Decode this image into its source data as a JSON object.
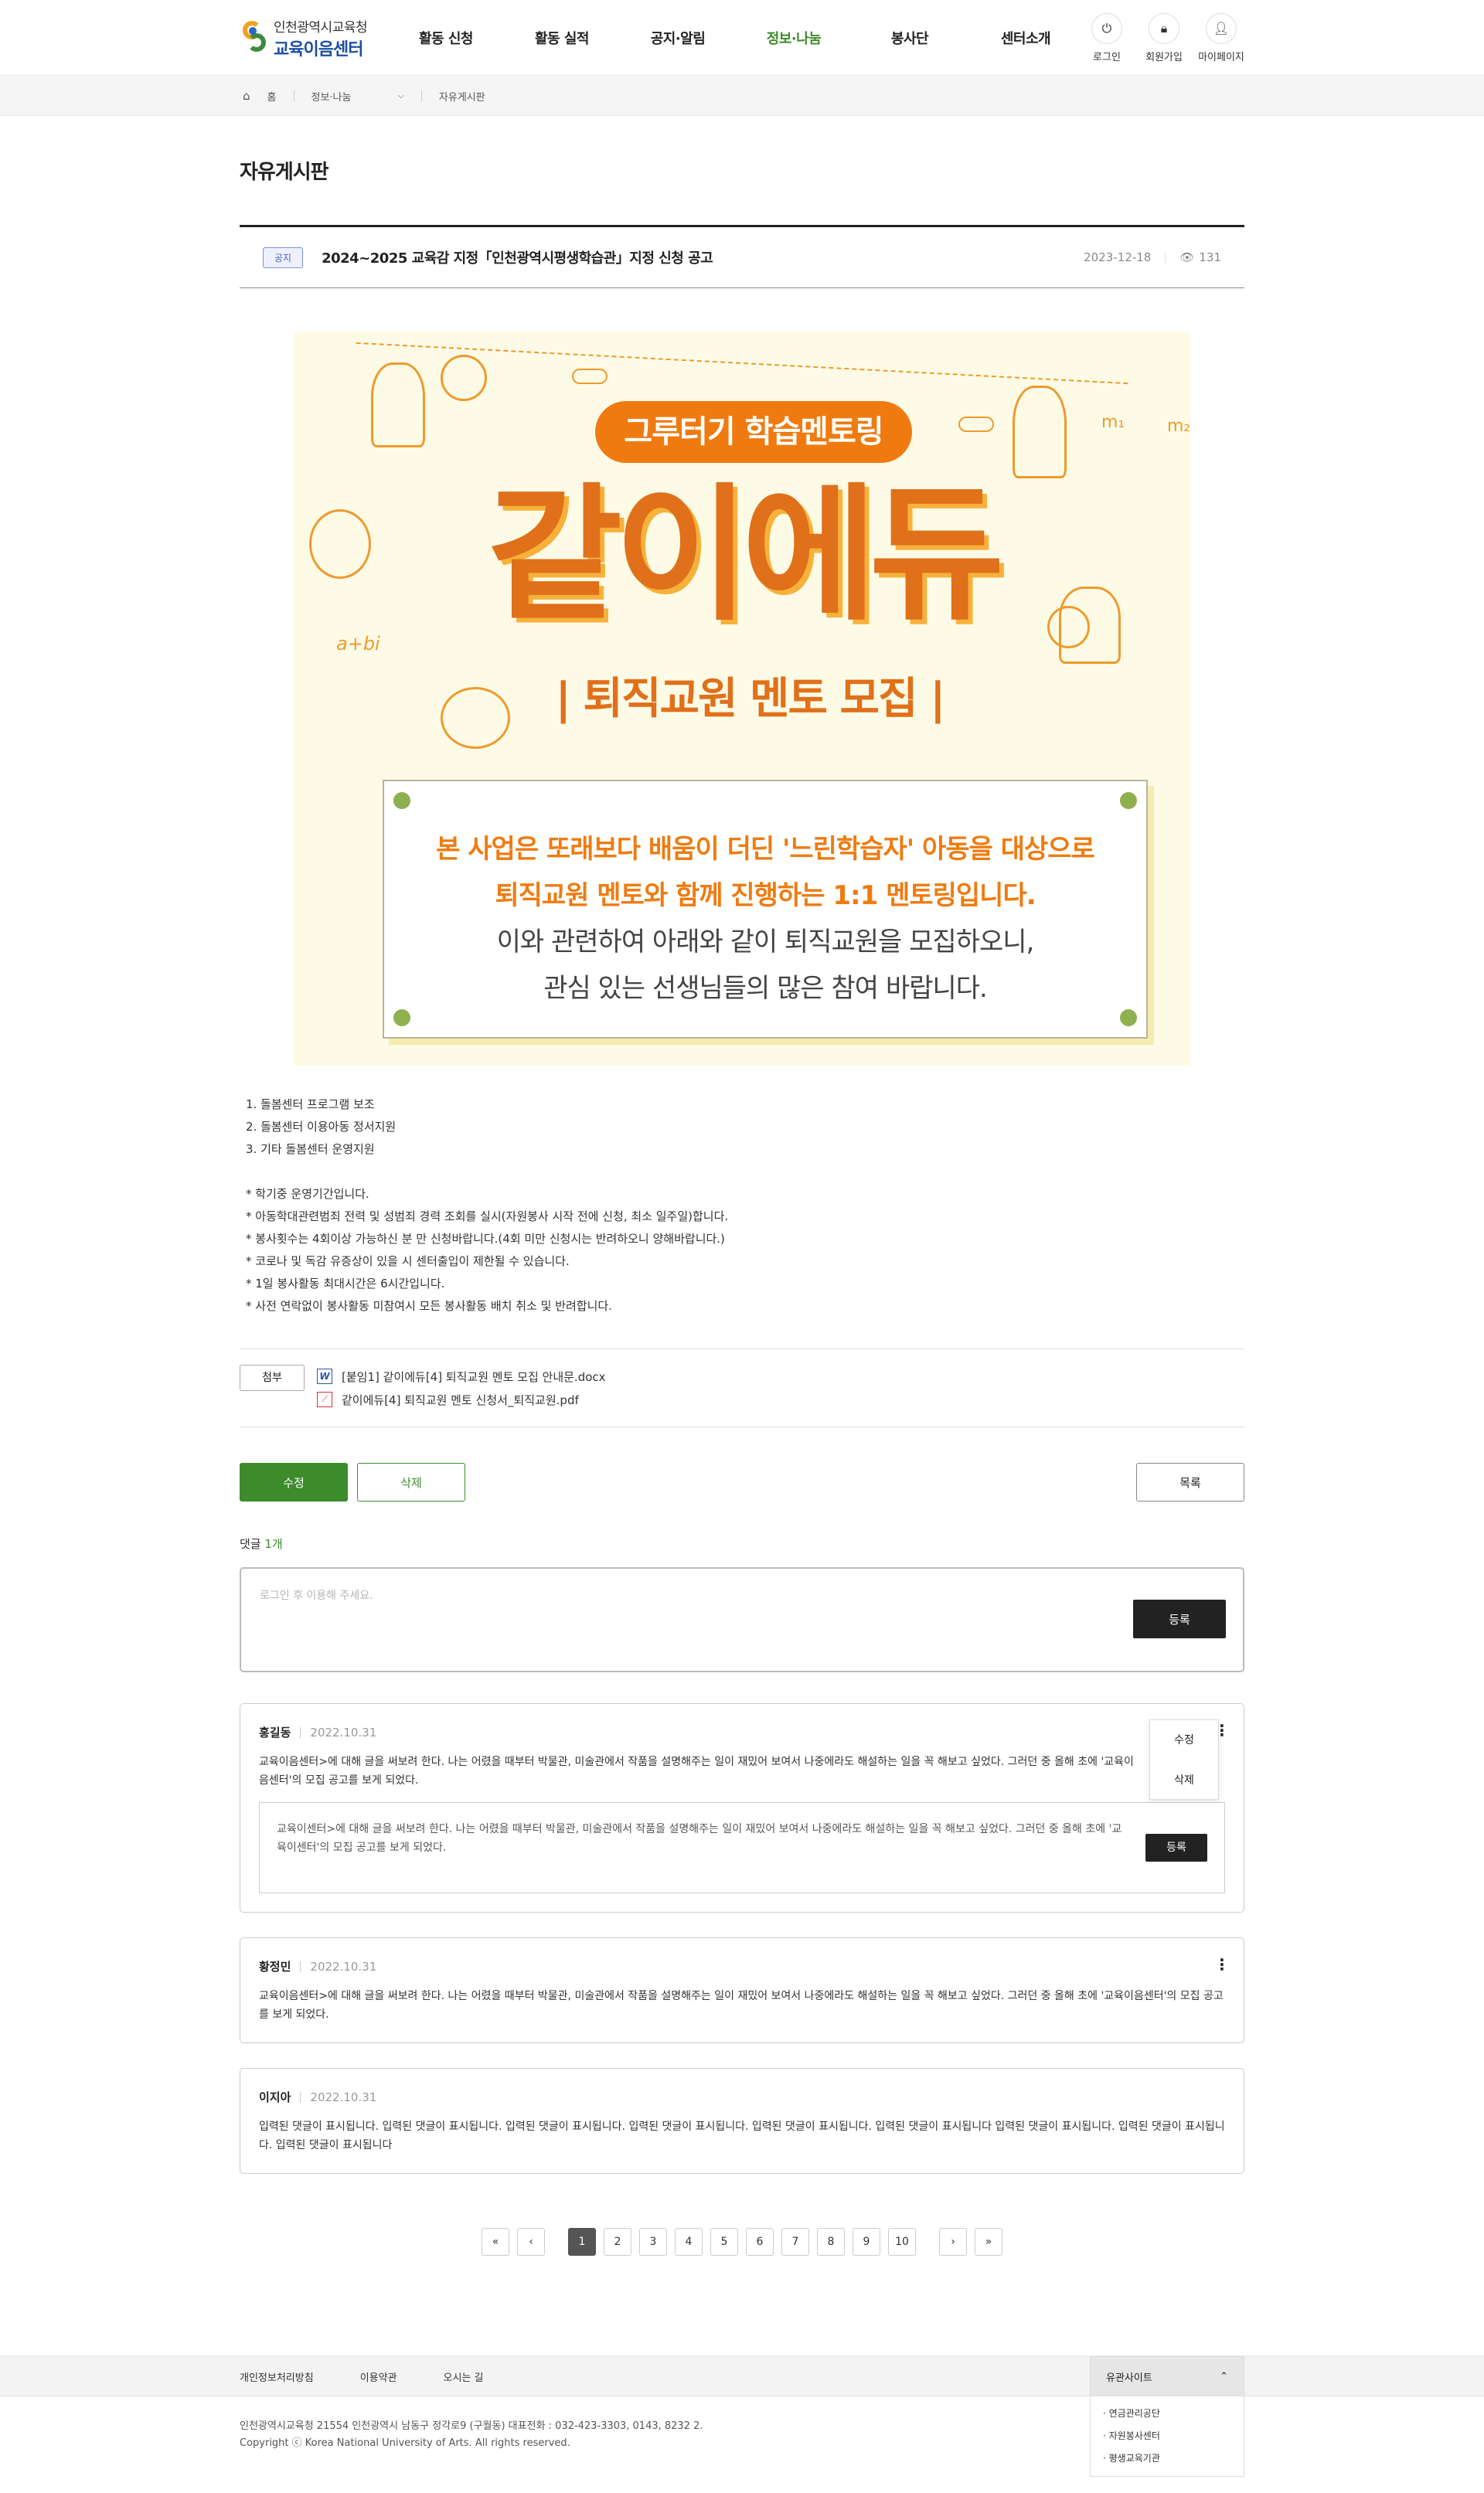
{
  "header": {
    "logo_top": "인천광역시교육청",
    "logo_main": "교육이음센터",
    "nav": [
      "활동 신청",
      "활동 실적",
      "공지·알림",
      "정보·나눔",
      "봉사단",
      "센터소개"
    ],
    "util": {
      "login": "로그인",
      "signup": "회원가입",
      "mypage": "마이페이지"
    }
  },
  "breadcrumb": {
    "home": "홈",
    "section": "정보·나눔",
    "page": "자유게시판"
  },
  "page_title": "자유게시판",
  "post": {
    "badge": "공지",
    "title": "2024~2025 교육감 지정「인천광역시평생학습관」지정 신청 공고",
    "date": "2023-12-18",
    "views": "131"
  },
  "poster": {
    "pill": "그루터기 학습멘토링",
    "headline": "같이에듀",
    "subline": "| 퇴직교원 멘토 모집 |",
    "line1": "본 사업은 또래보다 배움이 더딘 '느린학습자' 아동을 대상으로",
    "line2": "퇴직교원 멘토와 함께 진행하는 1:1 멘토링입니다.",
    "line3": "이와 관련하여 아래와 같이 퇴직교원을 모집하오니,",
    "line4": "관심 있는 선생님들의 많은 참여 바랍니다.",
    "formula": "a+bi",
    "m1": "m₁",
    "m2": "m₂"
  },
  "body": {
    "items": [
      "1. 돌봄센터 프로그램 보조",
      "2. 돌봄센터 이용아동 정서지원",
      "3. 기타 돌봄센터 운영지원"
    ],
    "notes": [
      "* 학기중 운영기간입니다.",
      "* 아동학대관련범죄 전력 및 성범죄 경력 조회를 실시(자원봉사 시작 전에 신청, 최소 일주일)합니다.",
      "* 봉사횟수는 4회이상 가능하신 분 만 신청바랍니다.(4회 미만 신청시는 반려하오니 양해바랍니다.)",
      "* 코로나 및 독감 유증상이 있을 시 센터출입이 제한될 수 있습니다.",
      "* 1일 봉사활동 최대시간은 6시간입니다.",
      "* 사전 연락없이 봉사활동 미참여시 모든 봉사활동 배치 취소 및 반려합니다."
    ]
  },
  "attach": {
    "label": "첨부",
    "files": [
      "[붙임1] 같이에듀[4] 퇴직교원 멘토 모집 안내문.docx",
      "같이에듀[4] 퇴직교원 멘토 신청서_퇴직교원.pdf"
    ]
  },
  "buttons": {
    "edit": "수정",
    "delete": "삭제",
    "list": "목록"
  },
  "comments": {
    "count_label": "댓글",
    "count": "1개",
    "placeholder": "로그인 후 이용해 주세요.",
    "submit": "등록",
    "menu": {
      "edit": "수정",
      "delete": "삭제"
    },
    "items": [
      {
        "name": "홍길동",
        "date": "2022.10.31",
        "text": "교육이음센터>에 대해 글을 써보려 한다. 나는 어렸을 때부터 박물관, 미술관에서 작품을 설명해주는 일이 재밌어 보여서 나중에라도 해설하는 일을 꼭 해보고 싶었다. 그러던 중 올해 초에 '교육이음센터'의 모집 공고를 보게 되었다.",
        "reply": "교육이센터>에 대해 글을 써보려 한다. 나는 어렸을 때부터 박물관, 미술관에서 작품을 설명해주는 일이 재밌어 보여서 나중에라도 해설하는 일을 꼭 해보고 싶었다. 그러던 중 올해 초에 '교육이센터'의 모집 공고를 보게 되었다."
      },
      {
        "name": "황정민",
        "date": "2022.10.31",
        "text": "교육이음센터>에 대해 글을 써보려 한다. 나는 어렸을 때부터 박물관, 미술관에서 작품을 설명해주는 일이 재밌어 보여서 나중에라도 해설하는 일을 꼭 해보고 싶었다. 그러던 중 올해 초에 '교육이음센터'의 모집 공고를 보게 되었다."
      },
      {
        "name": "이지아",
        "date": "2022.10.31",
        "text": "입력된 댓글이 표시됩니다. 입력된 댓글이 표시됩니다. 입력된 댓글이 표시됩니다. 입력된 댓글이 표시됩니다. 입력된 댓글이 표시됩니다. 입력된 댓글이 표시됩니다 입력된 댓글이 표시됩니다. 입력된 댓글이 표시됩니다. 입력된 댓글이 표시됩니다"
      }
    ]
  },
  "pager": {
    "first": "«",
    "prev": "‹",
    "pages": [
      "1",
      "2",
      "3",
      "4",
      "5",
      "6",
      "7",
      "8",
      "9",
      "10"
    ],
    "current": "1",
    "next": "›",
    "last": "»"
  },
  "footer": {
    "links": [
      "개인정보처리방침",
      "이용약관",
      "오시는 길"
    ],
    "family_title": "유관사이트",
    "family_sites": [
      "연금관리공단",
      "자원봉사센터",
      "평생교육기관"
    ],
    "address": "인천광역시교육청 21554 인천광역시 남동구 정각로9 (구월동) 대표전화 : 032-423-3303, 0143, 8232 2.",
    "copyright": "Copyright ⓒ Korea National University of Arts. All rights reserved."
  },
  "colors": {
    "accent_green": "#3c8c2c",
    "poster_orange": "#ef7b10",
    "badge_blue": "#4b5fb8"
  }
}
